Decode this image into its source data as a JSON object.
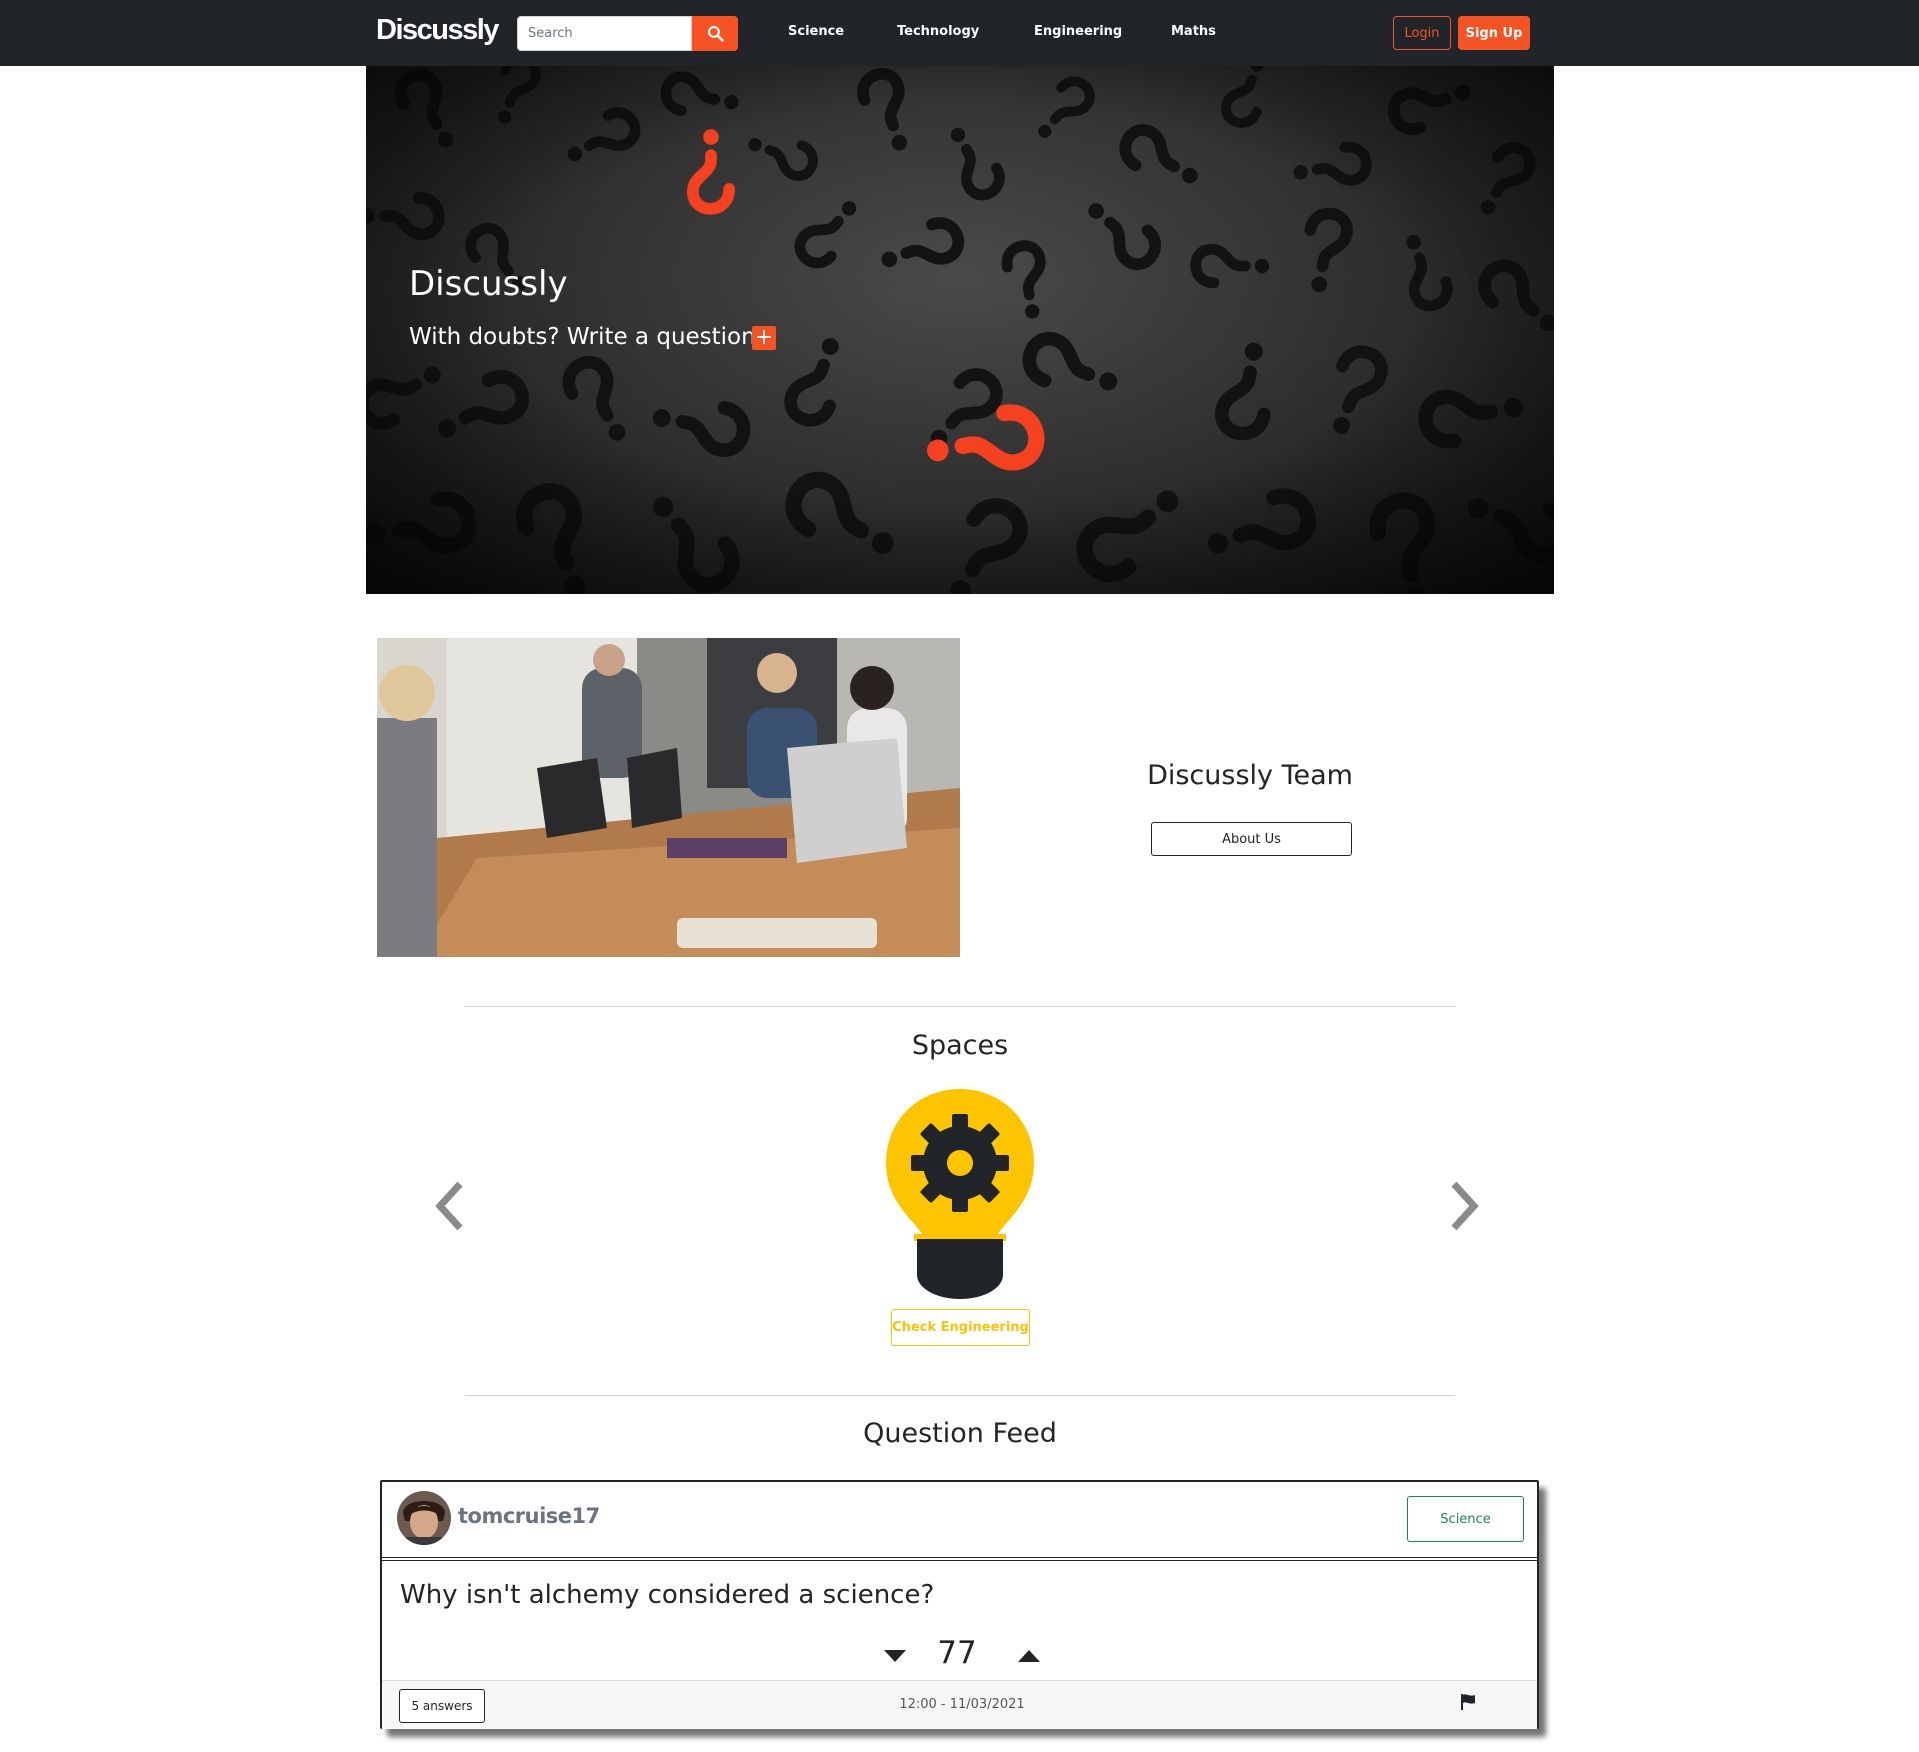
{
  "navbar": {
    "brand": "Discussly",
    "search_placeholder": "Search",
    "search_icon": "search-icon",
    "links": [
      "Science",
      "Technology",
      "Engineering",
      "Maths"
    ],
    "login_label": "Login",
    "signup_label": "Sign Up",
    "accent_color": "#f55323",
    "background_color": "#212529"
  },
  "hero": {
    "title": "Discussly",
    "subtitle": "With doubts? Write a question!",
    "add_icon": "plus-square-icon",
    "image": "question-marks-photo"
  },
  "team": {
    "image": "team-meeting-photo",
    "title": "Discussly Team",
    "about_label": "About Us"
  },
  "spaces": {
    "title": "Spaces",
    "current_icon": "lightbulb-gear-icon",
    "check_label": "Check Engineering",
    "prev_icon": "chevron-left-icon",
    "next_icon": "chevron-right-icon",
    "highlight_color": "#ffc107"
  },
  "feed": {
    "title": "Question Feed",
    "questions": [
      {
        "username": "tomcruise17",
        "tag": "Science",
        "question": "Why isn't alchemy considered a science?",
        "votes": "77",
        "answers_label": "5 answers",
        "timestamp": "12:00 - 11/03/2021",
        "flag_icon": "flag-icon"
      }
    ]
  }
}
